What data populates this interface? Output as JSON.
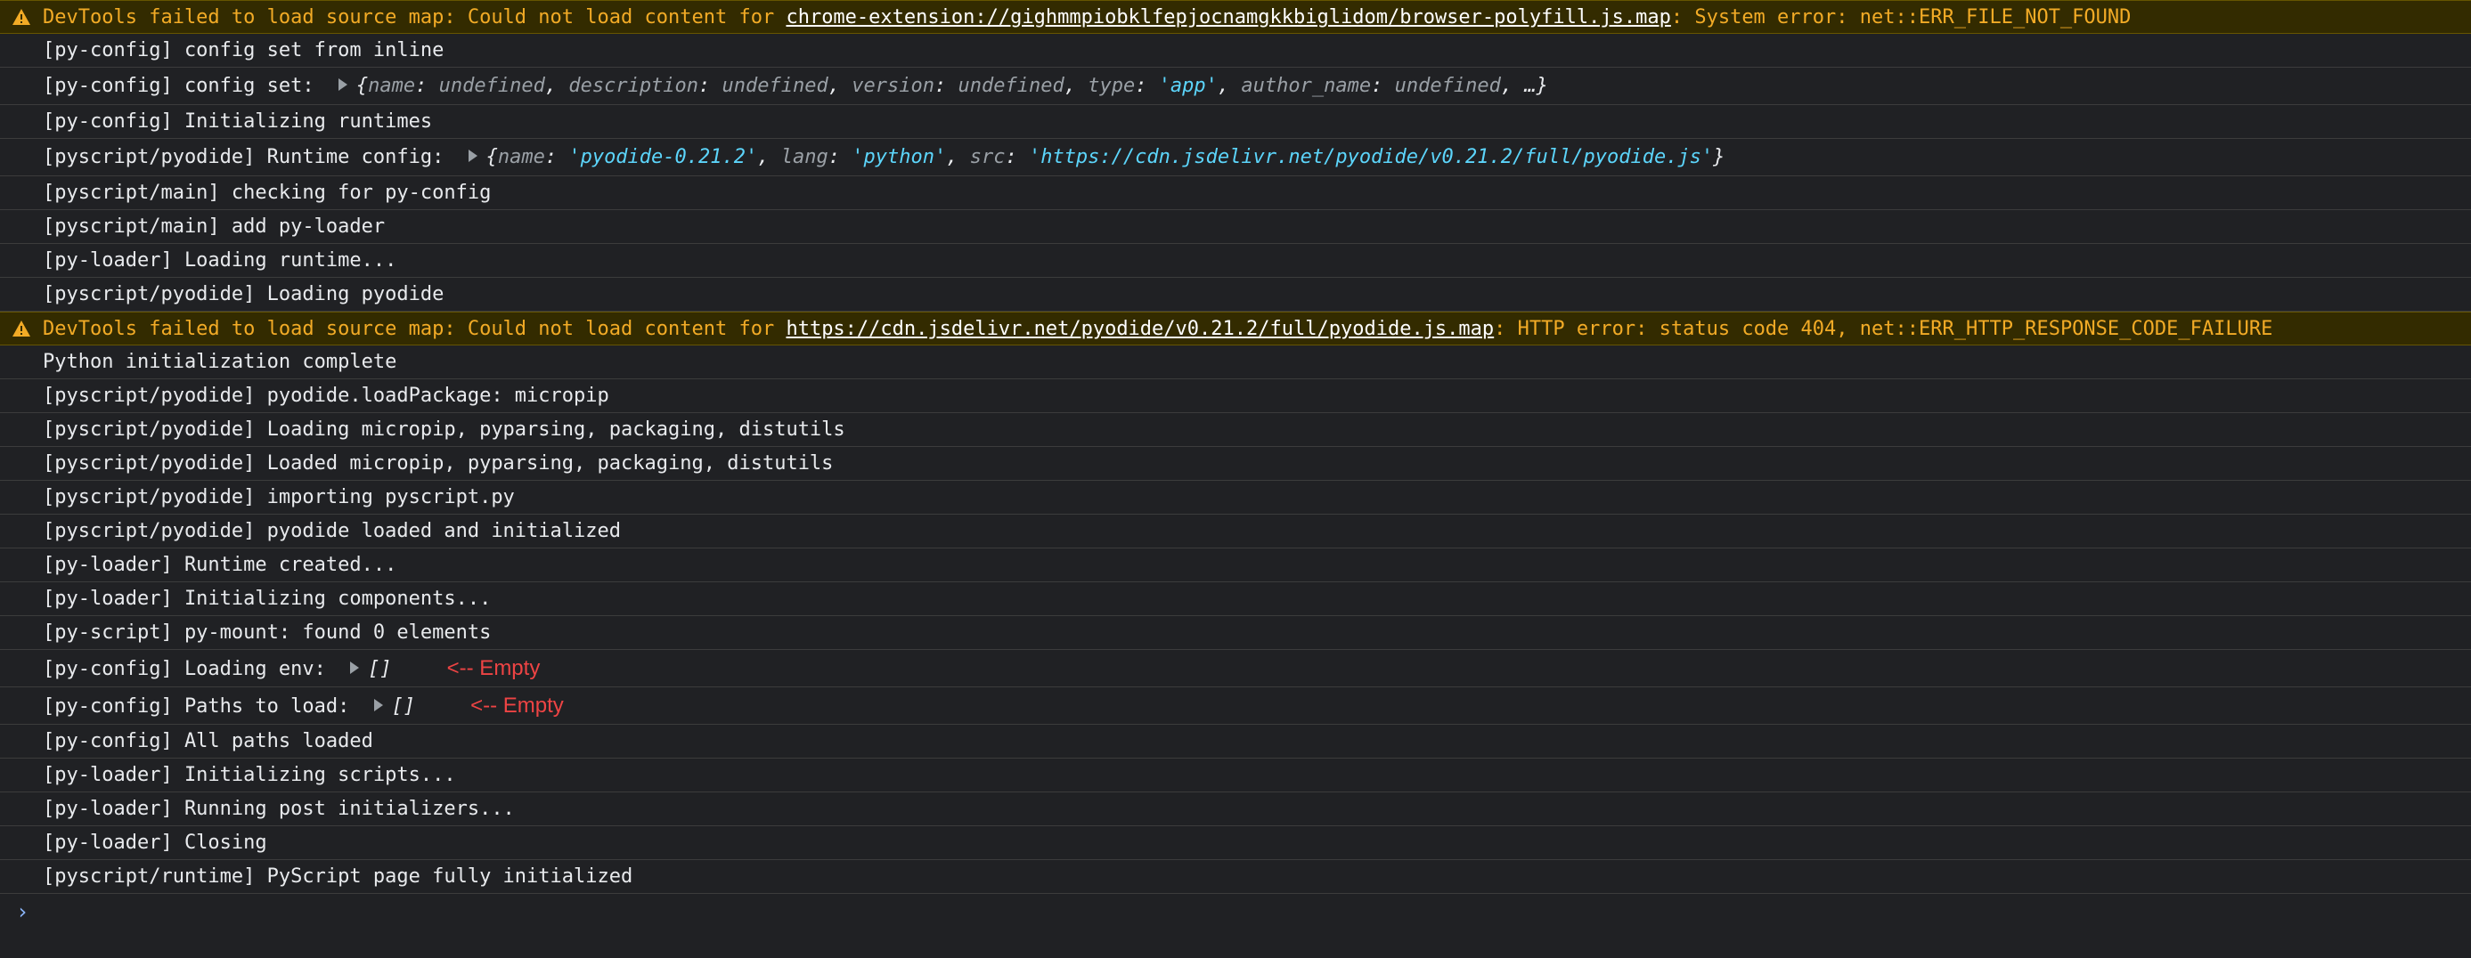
{
  "warnings": [
    {
      "prefix": "DevTools failed to load source map: Could not load content for ",
      "link": "chrome-extension://gighmmpiobklfepjocnamgkkbiglidom/browser-polyfill.js.map",
      "suffix": ": System error: net::ERR_FILE_NOT_FOUND"
    },
    {
      "prefix": "DevTools failed to load source map: Could not load content for ",
      "link": "https://cdn.jsdelivr.net/pyodide/v0.21.2/full/pyodide.js.map",
      "suffix": ": HTTP error: status code 404, net::ERR_HTTP_RESPONSE_CODE_FAILURE"
    }
  ],
  "logs1": [
    "[py-config] config set from inline"
  ],
  "config_set": {
    "prefix": "[py-config] config set: ",
    "brace_open": "{",
    "k_name": "name",
    "v_name": "undefined",
    "k_description": "description",
    "v_description": "undefined",
    "k_version": "version",
    "v_version": "undefined",
    "k_type": "type",
    "v_type": "'app'",
    "k_author": "author_name",
    "v_author": "undefined",
    "tail": "…}"
  },
  "logs2": [
    "[py-config] Initializing runtimes"
  ],
  "runtime_config": {
    "prefix": "[pyscript/pyodide] Runtime config: ",
    "brace_open": "{",
    "k_name": "name",
    "v_name": "'pyodide-0.21.2'",
    "k_lang": "lang",
    "v_lang": "'python'",
    "k_src": "src",
    "v_src": "'https://cdn.jsdelivr.net/pyodide/v0.21.2/full/pyodide.js'",
    "brace_close": "}"
  },
  "logs3": [
    "[pyscript/main] checking for py-config",
    "[pyscript/main] add py-loader",
    "[py-loader] Loading runtime...",
    "[pyscript/pyodide] Loading pyodide"
  ],
  "logs4": [
    "Python initialization complete",
    "[pyscript/pyodide] pyodide.loadPackage: micropip",
    "[pyscript/pyodide] Loading micropip, pyparsing, packaging, distutils",
    "[pyscript/pyodide] Loaded micropip, pyparsing, packaging, distutils",
    "[pyscript/pyodide] importing pyscript.py",
    "[pyscript/pyodide] pyodide loaded and initialized",
    "[py-loader] Runtime created...",
    "[py-loader] Initializing components...",
    "[py-script] py-mount: found 0 elements"
  ],
  "env_row": {
    "prefix": "[py-config] Loading env: ",
    "value": "[]",
    "note": "<-- Empty"
  },
  "paths_row": {
    "prefix": "[py-config] Paths to load: ",
    "value": "[]",
    "note": "<-- Empty"
  },
  "logs5": [
    "[py-config] All paths loaded",
    "[py-loader] Initializing scripts...",
    "[py-loader] Running post initializers...",
    "[py-loader] Closing",
    "[pyscript/runtime] PyScript page fully initialized"
  ],
  "prompt": {
    "symbol": "›"
  },
  "colors": {
    "background": "#202124",
    "warning_text": "#f2ab26",
    "warning_bg": "#332b00",
    "string": "#5cd5fb",
    "note": "#ee4444"
  }
}
